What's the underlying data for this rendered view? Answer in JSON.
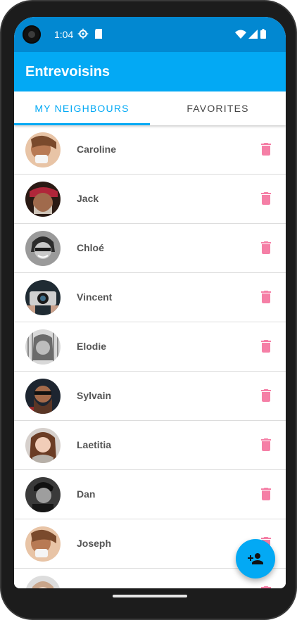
{
  "status_bar": {
    "time": "1:04",
    "icons": [
      "settings-gear-icon",
      "sd-card-icon",
      "wifi-icon",
      "signal-icon",
      "battery-icon"
    ]
  },
  "app_bar": {
    "title": "Entrevoisins",
    "color": "#03a9f4"
  },
  "tabs": [
    {
      "label": "MY NEIGHBOURS",
      "active": true
    },
    {
      "label": "FAVORITES",
      "active": false
    }
  ],
  "neighbours": [
    {
      "name": "Caroline"
    },
    {
      "name": "Jack"
    },
    {
      "name": "Chloé"
    },
    {
      "name": "Vincent"
    },
    {
      "name": "Elodie"
    },
    {
      "name": "Sylvain"
    },
    {
      "name": "Laetitia"
    },
    {
      "name": "Dan"
    },
    {
      "name": "Joseph"
    },
    {
      "name": ""
    }
  ],
  "colors": {
    "accent": "#03a9f4",
    "status_bar": "#0288d1",
    "delete_icon": "#f57fa6"
  },
  "fab": {
    "icon": "person-add-icon"
  }
}
